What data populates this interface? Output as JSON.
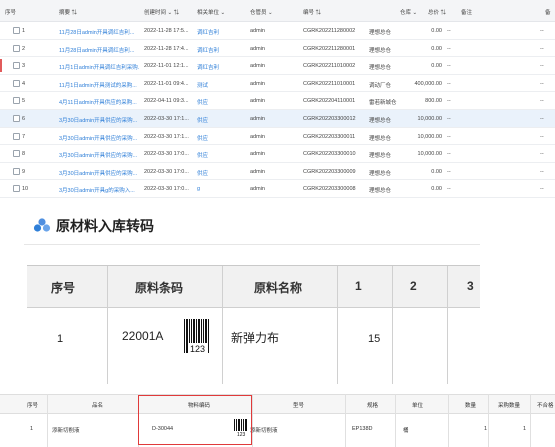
{
  "list": {
    "headers": {
      "seq": "序号",
      "summary": "摘要",
      "created": "创建时间",
      "unit": "相关单位",
      "storekeeper": "仓管员",
      "number": "编号",
      "warehouse": "仓库",
      "total": "总价",
      "remark": "备注",
      "extra": "备"
    },
    "rows": [
      {
        "seq": "1",
        "summary": "11月28日admin开具调红吉利...",
        "created": "2022-11-28 17:5...",
        "unit": "调红吉利",
        "storekeeper": "admin",
        "number": "CGRK202211280002",
        "warehouse": "理想总仓",
        "total": "0.00",
        "remark": "--",
        "mark": false
      },
      {
        "seq": "2",
        "summary": "11月28日admin开具调红吉利...",
        "created": "2022-11-28 17:4...",
        "unit": "调红吉利",
        "storekeeper": "admin",
        "number": "CGRK202211280001",
        "warehouse": "理想总仓",
        "total": "0.00",
        "remark": "--",
        "mark": false
      },
      {
        "seq": "3",
        "summary": "11月1日admin开具调红吉利采购...",
        "created": "2022-11-01 12:1...",
        "unit": "调红吉利",
        "storekeeper": "admin",
        "number": "CGRK202211010002",
        "warehouse": "理想总仓",
        "total": "0.00",
        "remark": "--",
        "mark": true
      },
      {
        "seq": "4",
        "summary": "11月1日admin开具测试的采购...",
        "created": "2022-11-01 09:4...",
        "unit": "测试",
        "storekeeper": "admin",
        "number": "CGRK202211010001",
        "warehouse": "调动厂仓",
        "total": "400,000.00",
        "remark": "--",
        "mark": false
      },
      {
        "seq": "5",
        "summary": "4月11日admin开具供应的采购...",
        "created": "2022-04-11 09:3...",
        "unit": "供应",
        "storekeeper": "admin",
        "number": "CGRK202204110001",
        "warehouse": "雷若新城仓",
        "total": "800.00",
        "remark": "--",
        "mark": false
      },
      {
        "seq": "6",
        "summary": "3月30日admin开具供应的采购...",
        "created": "2022-03-30 17:1...",
        "unit": "供应",
        "storekeeper": "admin",
        "number": "CGRK202203300012",
        "warehouse": "理想总仓",
        "total": "10,000.00",
        "remark": "--",
        "mark": false
      },
      {
        "seq": "7",
        "summary": "3月30日admin开具供应的采购...",
        "created": "2022-03-30 17:1...",
        "unit": "供应",
        "storekeeper": "admin",
        "number": "CGRK202203300011",
        "warehouse": "理想总仓",
        "total": "10,000.00",
        "remark": "--",
        "mark": false
      },
      {
        "seq": "8",
        "summary": "3月30日admin开具供应的采购...",
        "created": "2022-03-30 17:0...",
        "unit": "供应",
        "storekeeper": "admin",
        "number": "CGRK202203300010",
        "warehouse": "理想总仓",
        "total": "10,000.00",
        "remark": "--",
        "mark": false
      },
      {
        "seq": "9",
        "summary": "3月30日admin开具供应的采购...",
        "created": "2022-03-30 17:0...",
        "unit": "供应",
        "storekeeper": "admin",
        "number": "CGRK202203300009",
        "warehouse": "理想总仓",
        "total": "0.00",
        "remark": "--",
        "mark": false
      },
      {
        "seq": "10",
        "summary": "3月30日admin开具g的采购入...",
        "created": "2022-03-30 17:0...",
        "unit": "g",
        "storekeeper": "admin",
        "number": "CGRK202203300008",
        "warehouse": "理想总仓",
        "total": "0.00",
        "remark": "--",
        "mark": false
      }
    ],
    "highlight_row": 6
  },
  "section": {
    "title": "原材料入库转码",
    "icon": "cube-cluster-icon"
  },
  "barcode_table": {
    "headers": [
      "序号",
      "原料条码",
      "原料名称",
      "1",
      "2",
      "3"
    ],
    "row": {
      "seq": "1",
      "code": "22001A",
      "barcode_digits": "123",
      "name": "新弹力布",
      "col1": "15"
    }
  },
  "detail_table": {
    "headers": [
      "序号",
      "品名",
      "物料编码",
      "型号",
      "规格",
      "单位",
      "数量",
      "采购数量",
      "不合格"
    ],
    "row": {
      "seq": "1",
      "name": "添新切削液",
      "code": "D-30044",
      "barcode_digits": "123",
      "model": "添新切削液",
      "spec": "EP138D",
      "unit": "桶",
      "qty": "1",
      "purchase_qty": "1"
    }
  },
  "colors": {
    "link": "#2f7fd8",
    "accent_red": "#e03a3a",
    "highlight": "#eaf2fb",
    "icon_blue": "#2f7fd8"
  }
}
